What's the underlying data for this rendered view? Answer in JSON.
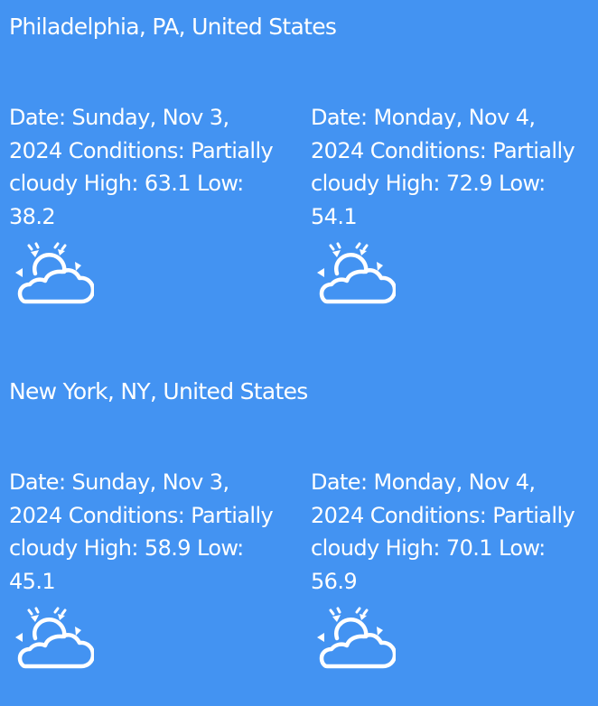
{
  "locations": [
    {
      "name": "Philadelphia, PA, United States",
      "days": [
        {
          "text": "Date: Sunday, Nov 3, 2024 Conditions: Partially cloudy High: 63.1 Low: 38.2",
          "icon": "partly-cloudy-day-icon"
        },
        {
          "text": "Date: Monday, Nov 4, 2024 Conditions: Partially cloudy High: 72.9 Low: 54.1",
          "icon": "partly-cloudy-day-icon"
        }
      ]
    },
    {
      "name": "New York, NY, United States",
      "days": [
        {
          "text": "Date: Sunday, Nov 3, 2024 Conditions: Partially cloudy High: 58.9 Low: 45.1",
          "icon": "partly-cloudy-day-icon"
        },
        {
          "text": "Date: Monday, Nov 4, 2024 Conditions: Partially cloudy High: 70.1 Low: 56.9",
          "icon": "partly-cloudy-day-icon"
        }
      ]
    }
  ],
  "colors": {
    "background": "#4393f2",
    "text": "#ffffff"
  }
}
